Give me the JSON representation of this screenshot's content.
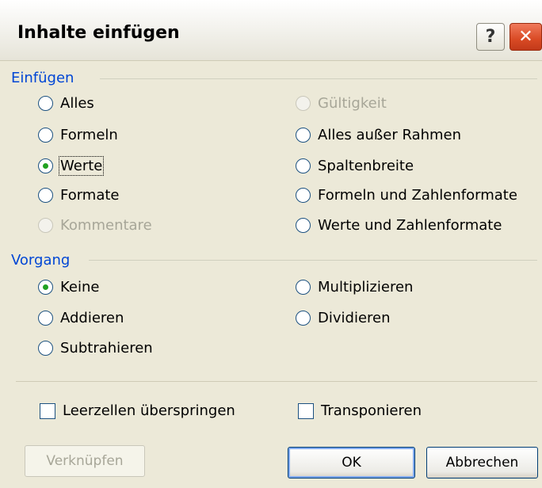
{
  "window": {
    "title": "Inhalte einfügen",
    "help_label": "?",
    "close_label": "✕"
  },
  "paste_group": {
    "label": "Einfügen",
    "left_options": [
      {
        "label": "Alles",
        "state": "unchecked"
      },
      {
        "label": "Formeln",
        "state": "unchecked"
      },
      {
        "label": "Werte",
        "state": "checked"
      },
      {
        "label": "Formate",
        "state": "unchecked"
      },
      {
        "label": "Kommentare",
        "state": "disabled"
      }
    ],
    "right_options": [
      {
        "label": "Gültigkeit",
        "state": "disabled"
      },
      {
        "label": "Alles außer Rahmen",
        "state": "unchecked"
      },
      {
        "label": "Spaltenbreite",
        "state": "unchecked"
      },
      {
        "label": "Formeln und Zahlenformate",
        "state": "unchecked"
      },
      {
        "label": "Werte und Zahlenformate",
        "state": "unchecked"
      }
    ]
  },
  "operation_group": {
    "label": "Vorgang",
    "left_options": [
      {
        "label": "Keine",
        "state": "checked"
      },
      {
        "label": "Addieren",
        "state": "unchecked"
      },
      {
        "label": "Subtrahieren",
        "state": "unchecked"
      }
    ],
    "right_options": [
      {
        "label": "Multiplizieren",
        "state": "unchecked"
      },
      {
        "label": "Dividieren",
        "state": "unchecked"
      }
    ]
  },
  "checkboxes": {
    "skip_blanks": {
      "label": "Leerzellen überspringen",
      "checked": false
    },
    "transpose": {
      "label": "Transponieren",
      "checked": false
    }
  },
  "buttons": {
    "link": "Verknüpfen",
    "ok": "OK",
    "cancel": "Abbrechen"
  }
}
